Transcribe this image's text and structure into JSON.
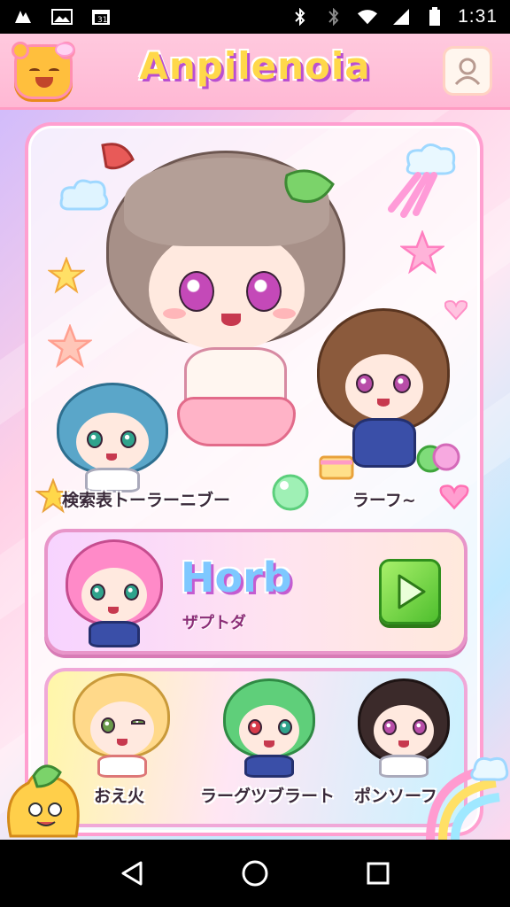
{
  "status_bar": {
    "time": "1:31",
    "icons": [
      "notification-a-icon",
      "photo-icon",
      "calendar-icon",
      "bluetooth-icon",
      "vibrate-icon",
      "wifi-icon",
      "signal-icon",
      "battery-icon"
    ]
  },
  "header": {
    "title": "Anpilenoia",
    "left_icon": "bear-mascot-icon",
    "right_icon": "profile-icon"
  },
  "hero": {
    "characters": [
      {
        "name": "検索表トーラーニブー"
      },
      {
        "name": "ラーフ~"
      }
    ]
  },
  "herb_card": {
    "title": "Horb",
    "subtitle": "ザプトダ",
    "action_icon": "play-arrow-icon"
  },
  "roster": {
    "characters": [
      {
        "name": "おえ火"
      },
      {
        "name": "ラーグツブラート"
      },
      {
        "name": "ポンソーフ"
      }
    ]
  },
  "nav": {
    "buttons": [
      "back-icon",
      "home-icon",
      "recents-icon"
    ]
  },
  "colors": {
    "header_bg": "#ffb8d4",
    "title_fill": "#ffd84a",
    "title_outline": "#b94fd1",
    "herb_title": "#7ec8ff",
    "play_green": "#4fbf2e",
    "panel_border": "#ff9fd0"
  }
}
